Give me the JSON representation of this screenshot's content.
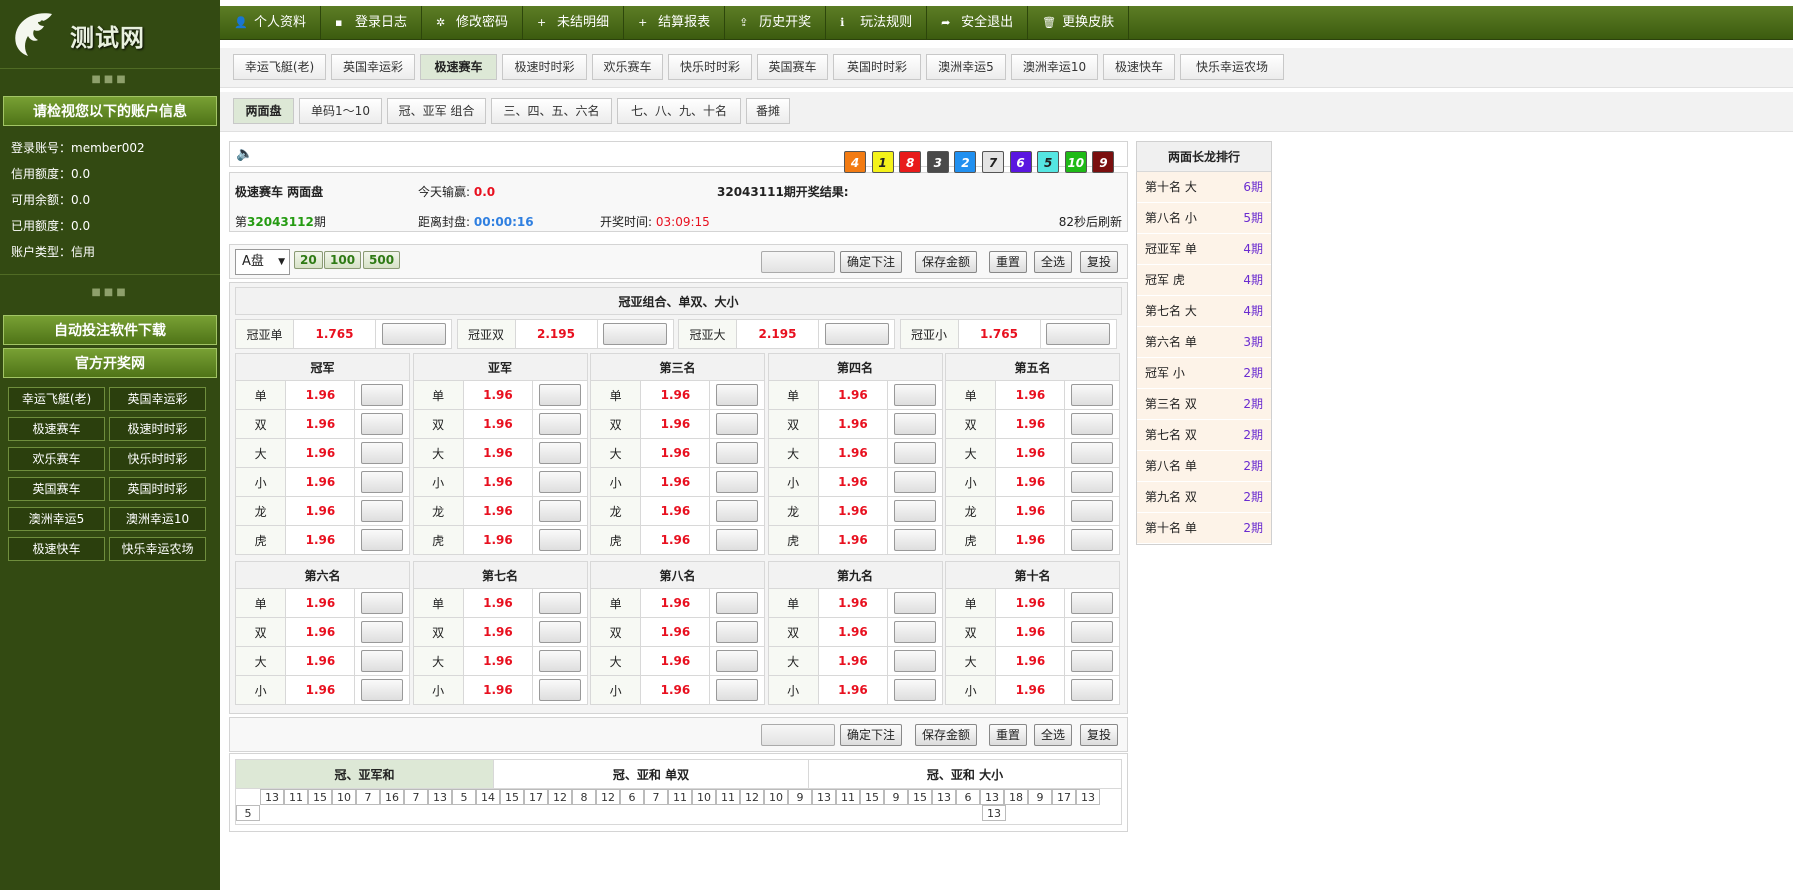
{
  "site": {
    "name": "测试网"
  },
  "sidebar": {
    "account_title": "请检视您以下的账户信息",
    "info": [
      {
        "label": "登录账号：",
        "value": "member002"
      },
      {
        "label": "信用额度：",
        "value": "0.0"
      },
      {
        "label": "可用余额：",
        "value": "0.0"
      },
      {
        "label": "已用额度：",
        "value": "0.0"
      },
      {
        "label": "账户类型：",
        "value": "信用"
      }
    ],
    "download_label": "自动投注软件下载",
    "official_label": "官方开奖网",
    "games": [
      "幸运飞艇(老)",
      "英国幸运彩",
      "极速赛车",
      "极速时时彩",
      "欢乐赛车",
      "快乐时时彩",
      "英国赛车",
      "英国时时彩",
      "澳洲幸运5",
      "澳洲幸运10",
      "极速快车",
      "快乐幸运农场"
    ]
  },
  "topnav": [
    {
      "icon": "user-icon",
      "glyph": "👤",
      "label": "个人资料"
    },
    {
      "icon": "chat-icon",
      "glyph": "▪",
      "label": "登录日志"
    },
    {
      "icon": "gear-icon",
      "glyph": "✲",
      "label": "修改密码"
    },
    {
      "icon": "plus-icon",
      "glyph": "+",
      "label": "未结明细"
    },
    {
      "icon": "plus-icon",
      "glyph": "+",
      "label": "结算报表"
    },
    {
      "icon": "upload-icon",
      "glyph": "⇪",
      "label": "历史开奖"
    },
    {
      "icon": "info-icon",
      "glyph": "ℹ",
      "label": "玩法规则"
    },
    {
      "icon": "share-icon",
      "glyph": "➦",
      "label": "安全退出"
    },
    {
      "icon": "trash-icon",
      "glyph": "🗑",
      "label": "更换皮肤"
    }
  ],
  "game_tabs": [
    "幸运飞艇(老)",
    "英国幸运彩",
    "极速赛车",
    "极速时时彩",
    "欢乐赛车",
    "快乐时时彩",
    "英国赛车",
    "英国时时彩",
    "澳洲幸运5",
    "澳洲幸运10",
    "极速快车",
    "快乐幸运农场"
  ],
  "sub_tabs": [
    "两面盘",
    "单码1～10",
    "冠、亚军 组合",
    "三、四、五、六名",
    "七、八、九、十名",
    "番摊"
  ],
  "info": {
    "game_title": "极速赛车 两面盘",
    "today_label": "今天输赢:",
    "today_value": "0.0",
    "result_label": "32043111期开奖结果:",
    "period_prefix": "第",
    "period_number": "32043112",
    "period_suffix": "期",
    "close_label": "距离封盘:",
    "close_value": "00:00:16",
    "draw_label": "开奖时间:",
    "draw_value": "03:09:15",
    "refresh": "82秒后刷新",
    "balls": [
      {
        "n": "4",
        "color": "#f27b13"
      },
      {
        "n": "1",
        "color": "#f4f21a"
      },
      {
        "n": "8",
        "color": "#e81b1b"
      },
      {
        "n": "3",
        "color": "#4a4a4a"
      },
      {
        "n": "2",
        "color": "#2190f0"
      },
      {
        "n": "7",
        "color": "#e4e4e4"
      },
      {
        "n": "6",
        "color": "#5a16e0"
      },
      {
        "n": "5",
        "color": "#55e6e2"
      },
      {
        "n": "10",
        "color": "#1fba17"
      },
      {
        "n": "9",
        "color": "#7a0f0f"
      }
    ]
  },
  "controls": {
    "pan": "A盘",
    "quick": [
      "20",
      "100",
      "500"
    ],
    "confirm": "确定下注",
    "save": "保存金额",
    "reset": "重置",
    "select_all": "全选",
    "repeat": "复投"
  },
  "combo": {
    "title": "冠亚组合、单双、大小",
    "items": [
      {
        "label": "冠亚单",
        "odds": "1.765"
      },
      {
        "label": "冠亚双",
        "odds": "2.195"
      },
      {
        "label": "冠亚大",
        "odds": "2.195"
      },
      {
        "label": "冠亚小",
        "odds": "1.765"
      }
    ]
  },
  "ranks_top": {
    "names": [
      "冠军",
      "亚军",
      "第三名",
      "第四名",
      "第五名"
    ],
    "rows": [
      "单",
      "双",
      "大",
      "小",
      "龙",
      "虎"
    ],
    "odds": "1.96"
  },
  "ranks_bottom": {
    "names": [
      "第六名",
      "第七名",
      "第八名",
      "第九名",
      "第十名"
    ],
    "rows": [
      "单",
      "双",
      "大",
      "小"
    ],
    "odds": "1.96"
  },
  "long_dragon": {
    "title": "两面长龙排行",
    "items": [
      {
        "label": "第十名 大",
        "count": "6期"
      },
      {
        "label": "第八名 小",
        "count": "5期"
      },
      {
        "label": "冠亚军 单",
        "count": "4期"
      },
      {
        "label": "冠军 虎",
        "count": "4期"
      },
      {
        "label": "第七名 大",
        "count": "4期"
      },
      {
        "label": "第六名 单",
        "count": "3期"
      },
      {
        "label": "冠军 小",
        "count": "2期"
      },
      {
        "label": "第三名 双",
        "count": "2期"
      },
      {
        "label": "第七名 双",
        "count": "2期"
      },
      {
        "label": "第八名 单",
        "count": "2期"
      },
      {
        "label": "第九名 双",
        "count": "2期"
      },
      {
        "label": "第十名 单",
        "count": "2期"
      }
    ]
  },
  "stats": {
    "tabs": [
      "冠、亚军和",
      "冠、亚和 单双",
      "冠、亚和 大小"
    ],
    "numbers": [
      "13",
      "11",
      "15",
      "10",
      "7",
      "16",
      "7",
      "13",
      "5",
      "14",
      "15",
      "17",
      "12",
      "8",
      "12",
      "6",
      "7",
      "11",
      "10",
      "11",
      "12",
      "10",
      "9",
      "13",
      "11",
      "15",
      "9",
      "15",
      "13",
      "6",
      "13",
      "18",
      "9",
      "17",
      "13",
      "5"
    ],
    "extra": "13"
  }
}
